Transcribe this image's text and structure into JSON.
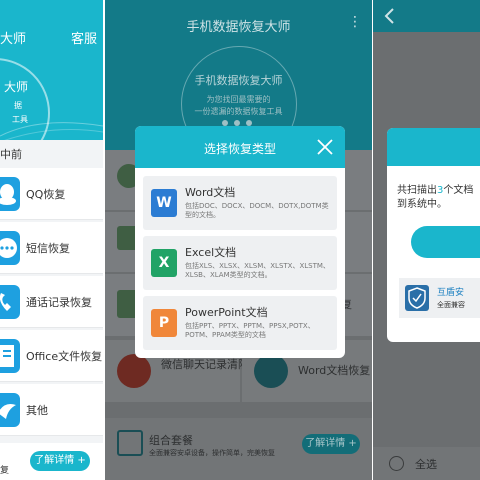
{
  "screen1": {
    "title": "大师",
    "service": "客服",
    "circle_title": "大师",
    "circle_sub1": "据",
    "circle_sub2": "工具",
    "date": "中前",
    "items": [
      {
        "label": "QQ恢复",
        "icon": "qq-penguin-icon"
      },
      {
        "label": "短信恢复",
        "icon": "sms-bubble-icon"
      },
      {
        "label": "通话记录恢复",
        "icon": "phone-call-icon"
      },
      {
        "label": "Office文件恢复",
        "icon": "office-doc-icon"
      },
      {
        "label": "其他",
        "icon": "other-icon"
      }
    ],
    "more_button": "了解详情 +",
    "bottom_text": "复"
  },
  "screen2": {
    "app_title": "手机数据恢复大师",
    "hero_title": "手机数据恢复大师",
    "hero_sub1": "为您找回最需要的",
    "hero_sub2": "一份遗漏的数据恢复工具",
    "row_wechat": "微信聊天记录清除",
    "row_word": "Word文档恢复",
    "row_partial": "复",
    "package_title": "组合套餐",
    "package_desc": "全面兼容安卓设备，操作简单，完美恢复",
    "package_button": "了解详情 +",
    "dialog": {
      "title": "选择恢复类型",
      "options": [
        {
          "name": "Word文档",
          "desc": "包括DOC、DOCX、DOCM、DOTX,DOTM类型的文档。",
          "icon_letter": "W",
          "color": "#2b7cd3"
        },
        {
          "name": "Excel文档",
          "desc": "包括XLS、XLSX、XLSM、XLSTX、XLSTM、XLSB、XLAM类型的文档。",
          "icon_letter": "X",
          "color": "#21a366"
        },
        {
          "name": "PowerPoint文档",
          "desc": "包括PPT、PPTX、PPTM、PPSX,POTX、POTM、PPAM类型的文档",
          "icon_letter": "P",
          "color": "#f0873a"
        }
      ]
    }
  },
  "screen3": {
    "back_icon": "back-chevron-icon",
    "msg_pre": "共扫描出",
    "msg_num": "3",
    "msg_post": "个文档",
    "msg_line2": "到系统中。",
    "ad_title": "互盾安",
    "ad_desc": "全面兼容",
    "select_all": "全选"
  }
}
